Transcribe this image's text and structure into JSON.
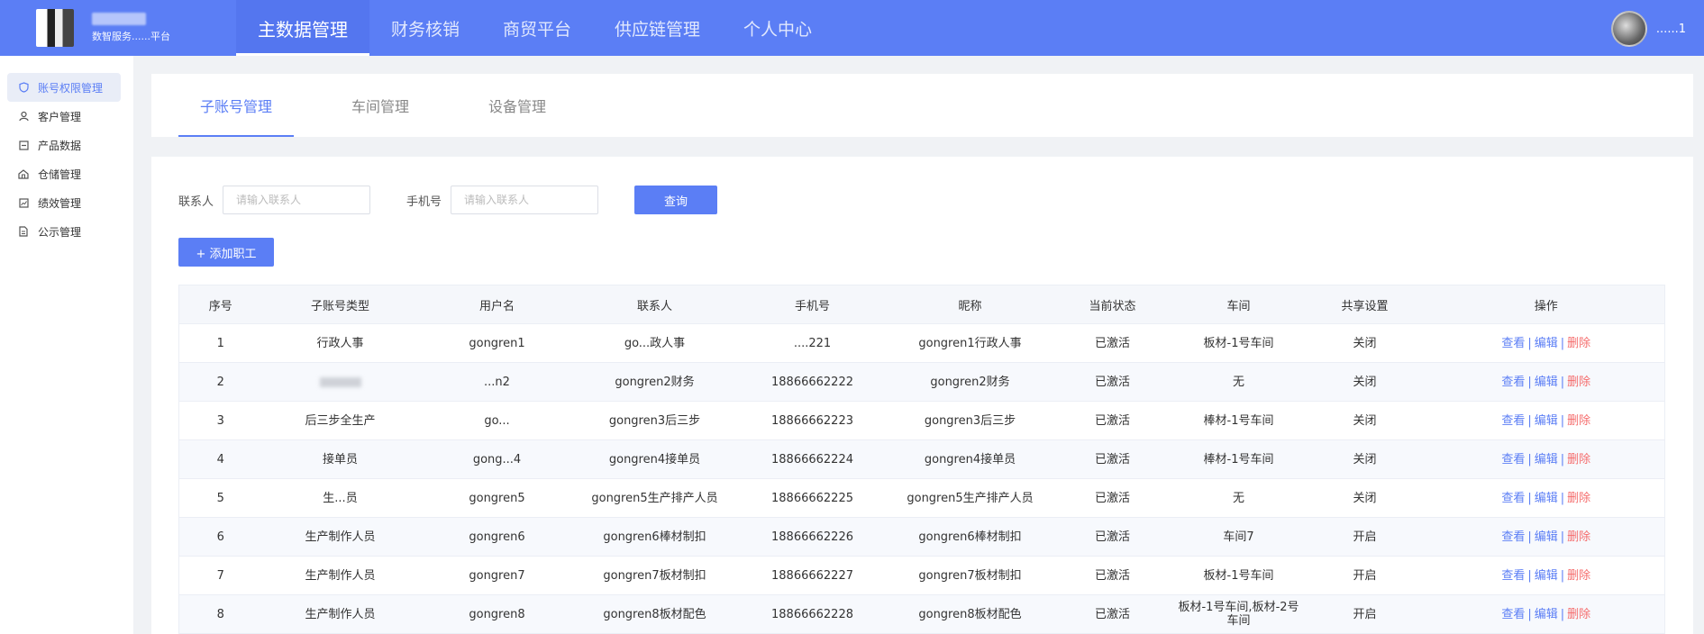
{
  "header": {
    "brand_sub": "数智服务......平台",
    "nav": [
      {
        "label": "主数据管理",
        "active": true
      },
      {
        "label": "财务核销",
        "active": false
      },
      {
        "label": "商贸平台",
        "active": false
      },
      {
        "label": "供应链管理",
        "active": false
      },
      {
        "label": "个人中心",
        "active": false
      }
    ],
    "user_name": "......1"
  },
  "sidebar": {
    "items": [
      {
        "label": "账号权限管理",
        "icon": "shield-icon",
        "active": true
      },
      {
        "label": "客户管理",
        "icon": "user-icon",
        "active": false
      },
      {
        "label": "产品数据",
        "icon": "box-icon",
        "active": false
      },
      {
        "label": "仓储管理",
        "icon": "warehouse-icon",
        "active": false
      },
      {
        "label": "绩效管理",
        "icon": "chart-icon",
        "active": false
      },
      {
        "label": "公示管理",
        "icon": "document-icon",
        "active": false
      }
    ]
  },
  "tabs": [
    {
      "label": "子账号管理",
      "active": true
    },
    {
      "label": "车间管理",
      "active": false
    },
    {
      "label": "设备管理",
      "active": false
    }
  ],
  "filter": {
    "contact_label": "联系人",
    "contact_placeholder": "请输入联系人",
    "contact_value": "",
    "phone_label": "手机号",
    "phone_placeholder": "请输入联系人",
    "phone_value": "",
    "query_label": "查询"
  },
  "add_button_label": "+ 添加职工",
  "table": {
    "headers": [
      "序号",
      "子账号类型",
      "用户名",
      "联系人",
      "手机号",
      "昵称",
      "当前状态",
      "车间",
      "共享设置",
      "操作"
    ],
    "ops": {
      "view": "查看",
      "edit": "编辑",
      "delete": "删除",
      "sep": "|"
    },
    "rows": [
      {
        "no": "1",
        "type": "行政人事",
        "username": "gongren1",
        "contact": "go...政人事",
        "phone": "....221",
        "nickname": "gongren1行政人事",
        "status": "已激活",
        "workshop": "板材-1号车间",
        "share": "关闭"
      },
      {
        "no": "2",
        "type": "",
        "username": "...n2",
        "contact": "gongren2财务",
        "phone": "18866662222",
        "nickname": "gongren2财务",
        "status": "已激活",
        "workshop": "无",
        "share": "关闭"
      },
      {
        "no": "3",
        "type": "后三步全生产",
        "username": "go...",
        "contact": "gongren3后三步",
        "phone": "18866662223",
        "nickname": "gongren3后三步",
        "status": "已激活",
        "workshop": "棒材-1号车间",
        "share": "关闭"
      },
      {
        "no": "4",
        "type": "接单员",
        "username": "gong...4",
        "contact": "gongren4接单员",
        "phone": "18866662224",
        "nickname": "gongren4接单员",
        "status": "已激活",
        "workshop": "棒材-1号车间",
        "share": "关闭"
      },
      {
        "no": "5",
        "type": "生...员",
        "username": "gongren5",
        "contact": "gongren5生产排产人员",
        "phone": "18866662225",
        "nickname": "gongren5生产排产人员",
        "status": "已激活",
        "workshop": "无",
        "share": "关闭"
      },
      {
        "no": "6",
        "type": "生产制作人员",
        "username": "gongren6",
        "contact": "gongren6棒材制扣",
        "phone": "18866662226",
        "nickname": "gongren6棒材制扣",
        "status": "已激活",
        "workshop": "车间7",
        "share": "开启"
      },
      {
        "no": "7",
        "type": "生产制作人员",
        "username": "gongren7",
        "contact": "gongren7板材制扣",
        "phone": "18866662227",
        "nickname": "gongren7板材制扣",
        "status": "已激活",
        "workshop": "板材-1号车间",
        "share": "开启"
      },
      {
        "no": "8",
        "type": "生产制作人员",
        "username": "gongren8",
        "contact": "gongren8板材配色",
        "phone": "18866662228",
        "nickname": "gongren8板材配色",
        "status": "已激活",
        "workshop": "板材-1号车间,板材-2号车间",
        "share": "开启"
      }
    ]
  }
}
